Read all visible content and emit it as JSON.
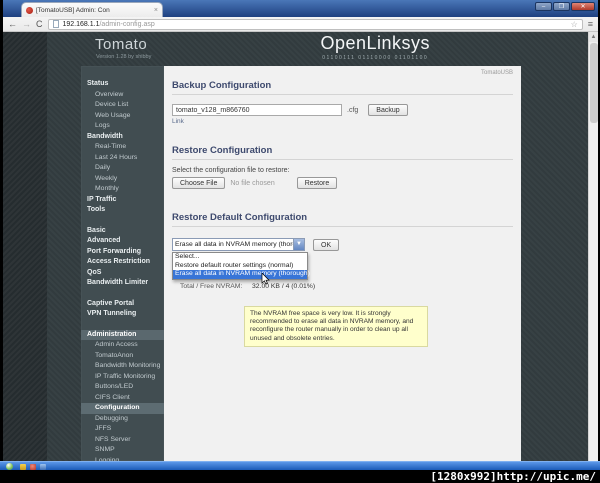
{
  "colors": {
    "accent-blue": "#3875d7",
    "titlebar-blue": "#2a4d8f",
    "page-bg": "#333d40",
    "menu-bg": "#414d51",
    "menu-active-bg": "#5a686e",
    "content-bg": "#f1f1f1",
    "heading-navy": "#3e4a6e",
    "warning-bg": "#ffffcc",
    "warning-border": "#d9d9a0",
    "taskbar-blue": "#2a6cd4",
    "close-red": "#c75050"
  },
  "browser": {
    "tab": {
      "title": "[TomatoUSB] Admin: Con",
      "close_glyph": "×"
    },
    "window_controls": {
      "minimize": "–",
      "restore": "❐",
      "close": "✕"
    },
    "toolbar": {
      "back": "←",
      "forward": "→",
      "reload": "C",
      "url_host": "192.168.1.1",
      "url_path": "/admin-config.asp",
      "bookmark_star": "☆",
      "menu": "≡"
    },
    "scrollbar_up_arrow": "▲"
  },
  "header": {
    "brand": "Tomato",
    "version": "Version 1.28 by shibby",
    "logo": "OpenLinksys",
    "logo_binary": "01100111 01110000 01101100",
    "corner_label": "TomatoUSB"
  },
  "sidebar": {
    "items": [
      {
        "label": "Status",
        "type": "section"
      },
      {
        "label": "Overview",
        "type": "item"
      },
      {
        "label": "Device List",
        "type": "item"
      },
      {
        "label": "Web Usage",
        "type": "item"
      },
      {
        "label": "Logs",
        "type": "item"
      },
      {
        "label": "Bandwidth",
        "type": "section"
      },
      {
        "label": "Real-Time",
        "type": "item"
      },
      {
        "label": "Last 24 Hours",
        "type": "item"
      },
      {
        "label": "Daily",
        "type": "item"
      },
      {
        "label": "Weekly",
        "type": "item"
      },
      {
        "label": "Monthly",
        "type": "item"
      },
      {
        "label": "IP Traffic",
        "type": "section"
      },
      {
        "label": "Tools",
        "type": "section"
      },
      {
        "type": "gap"
      },
      {
        "label": "Basic",
        "type": "section"
      },
      {
        "label": "Advanced",
        "type": "section"
      },
      {
        "label": "Port Forwarding",
        "type": "section"
      },
      {
        "label": "Access Restriction",
        "type": "section"
      },
      {
        "label": "QoS",
        "type": "section"
      },
      {
        "label": "Bandwidth Limiter",
        "type": "section"
      },
      {
        "type": "gap"
      },
      {
        "label": "Captive Portal",
        "type": "section"
      },
      {
        "label": "VPN Tunneling",
        "type": "section"
      },
      {
        "type": "gap"
      },
      {
        "label": "Administration",
        "type": "section",
        "state": "active"
      },
      {
        "label": "Admin Access",
        "type": "item"
      },
      {
        "label": "TomatoAnon",
        "type": "item"
      },
      {
        "label": "Bandwidth Monitoring",
        "type": "item"
      },
      {
        "label": "IP Traffic Monitoring",
        "type": "item"
      },
      {
        "label": "Buttons/LED",
        "type": "item"
      },
      {
        "label": "CIFS Client",
        "type": "item"
      },
      {
        "label": "Configuration",
        "type": "item",
        "state": "selected"
      },
      {
        "label": "Debugging",
        "type": "item"
      },
      {
        "label": "JFFS",
        "type": "item"
      },
      {
        "label": "NFS Server",
        "type": "item"
      },
      {
        "label": "SNMP",
        "type": "item"
      },
      {
        "label": "Logging",
        "type": "item"
      }
    ]
  },
  "main": {
    "backup": {
      "title": "Backup Configuration",
      "filename": "tomato_v128_m866760",
      "extension": ".cfg",
      "backup_button": "Backup",
      "link_label": "Link"
    },
    "restore": {
      "title": "Restore Configuration",
      "instruction": "Select the configuration file to restore:",
      "choose_file_button": "Choose File",
      "file_status": "No file chosen",
      "restore_button": "Restore"
    },
    "restore_default": {
      "title": "Restore Default Configuration",
      "selected_option": "Erase all data in NVRAM memory (thorough)",
      "dropdown_arrow": "▼",
      "ok_button": "OK",
      "options": [
        "Select...",
        "Restore default router settings (normal)",
        "Erase all data in NVRAM memory (thorough)"
      ],
      "highlighted_index": 2,
      "nvram_label": "Total / Free NVRAM:",
      "nvram_value": "32.00 KB / 4 (0.01%)",
      "warning": "The NVRAM free space is very low. It is strongly recommended to erase all data in NVRAM memory, and reconfigure the router manually in order to clean up all unused and obsolete entries."
    }
  },
  "taskbar": {
    "icons": [
      "start-orb-icon",
      "browser-icon",
      "folder-icon",
      "player-icon"
    ]
  },
  "watermark": "[1280x992]http://upic.me/"
}
